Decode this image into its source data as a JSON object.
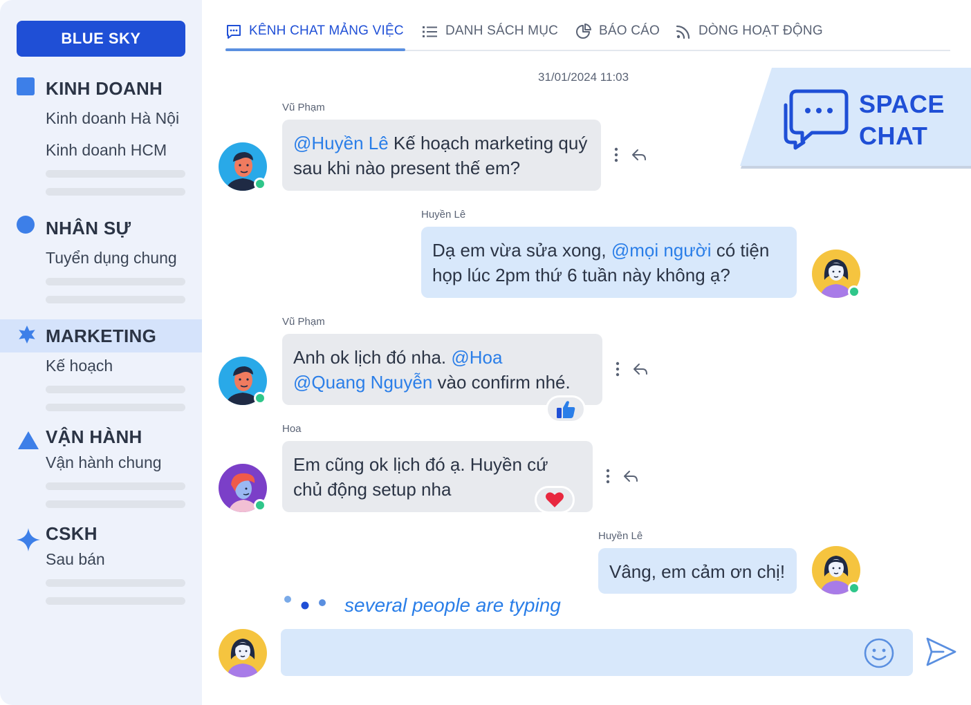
{
  "brand": "BLUE SKY",
  "sidebar": {
    "groups": [
      {
        "title": "KINH DOANH",
        "icon": "square-icon",
        "items": [
          "Kinh doanh Hà Nội",
          "Kinh doanh HCM"
        ]
      },
      {
        "title": "NHÂN SỰ",
        "icon": "circle-icon",
        "items": [
          "Tuyển dụng chung"
        ]
      },
      {
        "title": "MARKETING",
        "icon": "star-icon",
        "active": true,
        "items": [
          "Kế hoạch"
        ]
      },
      {
        "title": "VẬN HÀNH",
        "icon": "triangle-icon",
        "items": [
          "Vận hành chung"
        ]
      },
      {
        "title": "CSKH",
        "icon": "sparkle-icon",
        "items": [
          "Sau bán"
        ]
      }
    ]
  },
  "tabs": [
    {
      "label": "KÊNH CHAT MẢNG VIỆC",
      "icon": "chat-icon",
      "active": true
    },
    {
      "label": "DANH SÁCH MỤC",
      "icon": "list-icon"
    },
    {
      "label": "BÁO CÁO",
      "icon": "pie-chart-icon"
    },
    {
      "label": "DÒNG HOẠT ĐỘNG",
      "icon": "feed-icon"
    }
  ],
  "badge": {
    "line1": "SPACE",
    "line2": "CHAT",
    "icon": "chat-bubbles-icon"
  },
  "chat": {
    "timestamp": "31/01/2024 11:03",
    "messages": [
      {
        "sender": "Vũ Phạm",
        "direction": "incoming",
        "parts": {
          "m1": "@Huyền Lê",
          "t1": " Kế hoạch marketing quý sau khi nào present thế em?"
        }
      },
      {
        "sender": "Huyền Lê",
        "direction": "outgoing",
        "parts": {
          "t1": "Dạ em vừa sửa xong, ",
          "m1": "@mọi người",
          "t2": " có tiện họp lúc 2pm thứ 6 tuần này không ạ?"
        }
      },
      {
        "sender": "Vũ Phạm",
        "direction": "incoming",
        "parts": {
          "t1": "Anh ok lịch đó nha.  ",
          "m1": "@Hoa",
          "m2": "@Quang Nguyễn",
          "t2": " vào confirm nhé."
        },
        "reaction": "thumbs-up-icon"
      },
      {
        "sender": "Hoa",
        "direction": "incoming",
        "parts": {
          "t1": "Em cũng ok lịch đó ạ. Huyền cứ chủ động setup nha"
        },
        "reaction": "heart-icon"
      },
      {
        "sender": "Huyền Lê",
        "direction": "outgoing",
        "parts": {
          "t1": "Vâng, em cảm ơn chị!"
        }
      }
    ]
  },
  "typing": "several people are typing",
  "composer": {
    "value": "",
    "placeholder": ""
  },
  "colors": {
    "accent": "#1f4fd6",
    "mention": "#2a7ee8",
    "sidebar_bg": "#eef2fb",
    "bubble_in": "#e8eaee",
    "bubble_out": "#d8e8fb",
    "online": "#2fc68a"
  }
}
